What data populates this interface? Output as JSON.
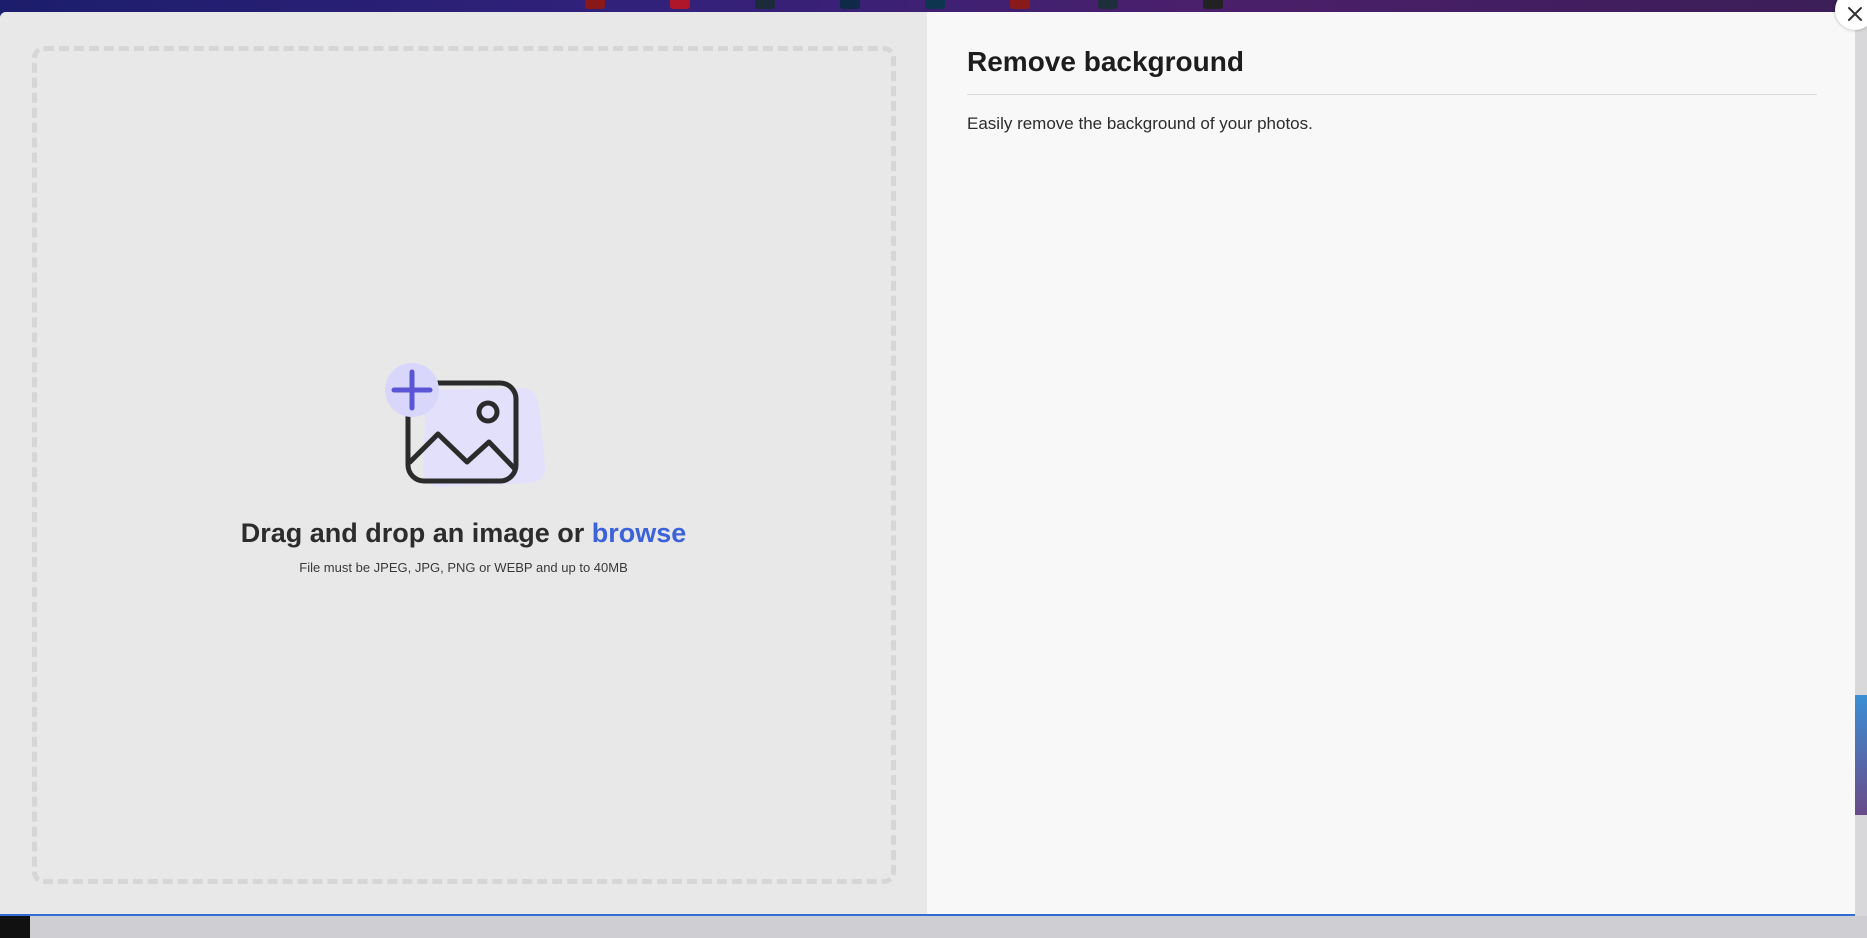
{
  "dropzone": {
    "title_prefix": "Drag and drop an image or ",
    "browse_label": "browse",
    "hint": "File must be JPEG, JPG, PNG or WEBP and up to 40MB"
  },
  "panel": {
    "title": "Remove background",
    "description": "Easily remove the background of your photos."
  },
  "icons": {
    "close": "close-icon",
    "upload": "image-add-icon"
  },
  "colors": {
    "accent": "#3b62d8",
    "illustration_plus": "#5b55d6",
    "illustration_bg": "#d9d6fb"
  }
}
